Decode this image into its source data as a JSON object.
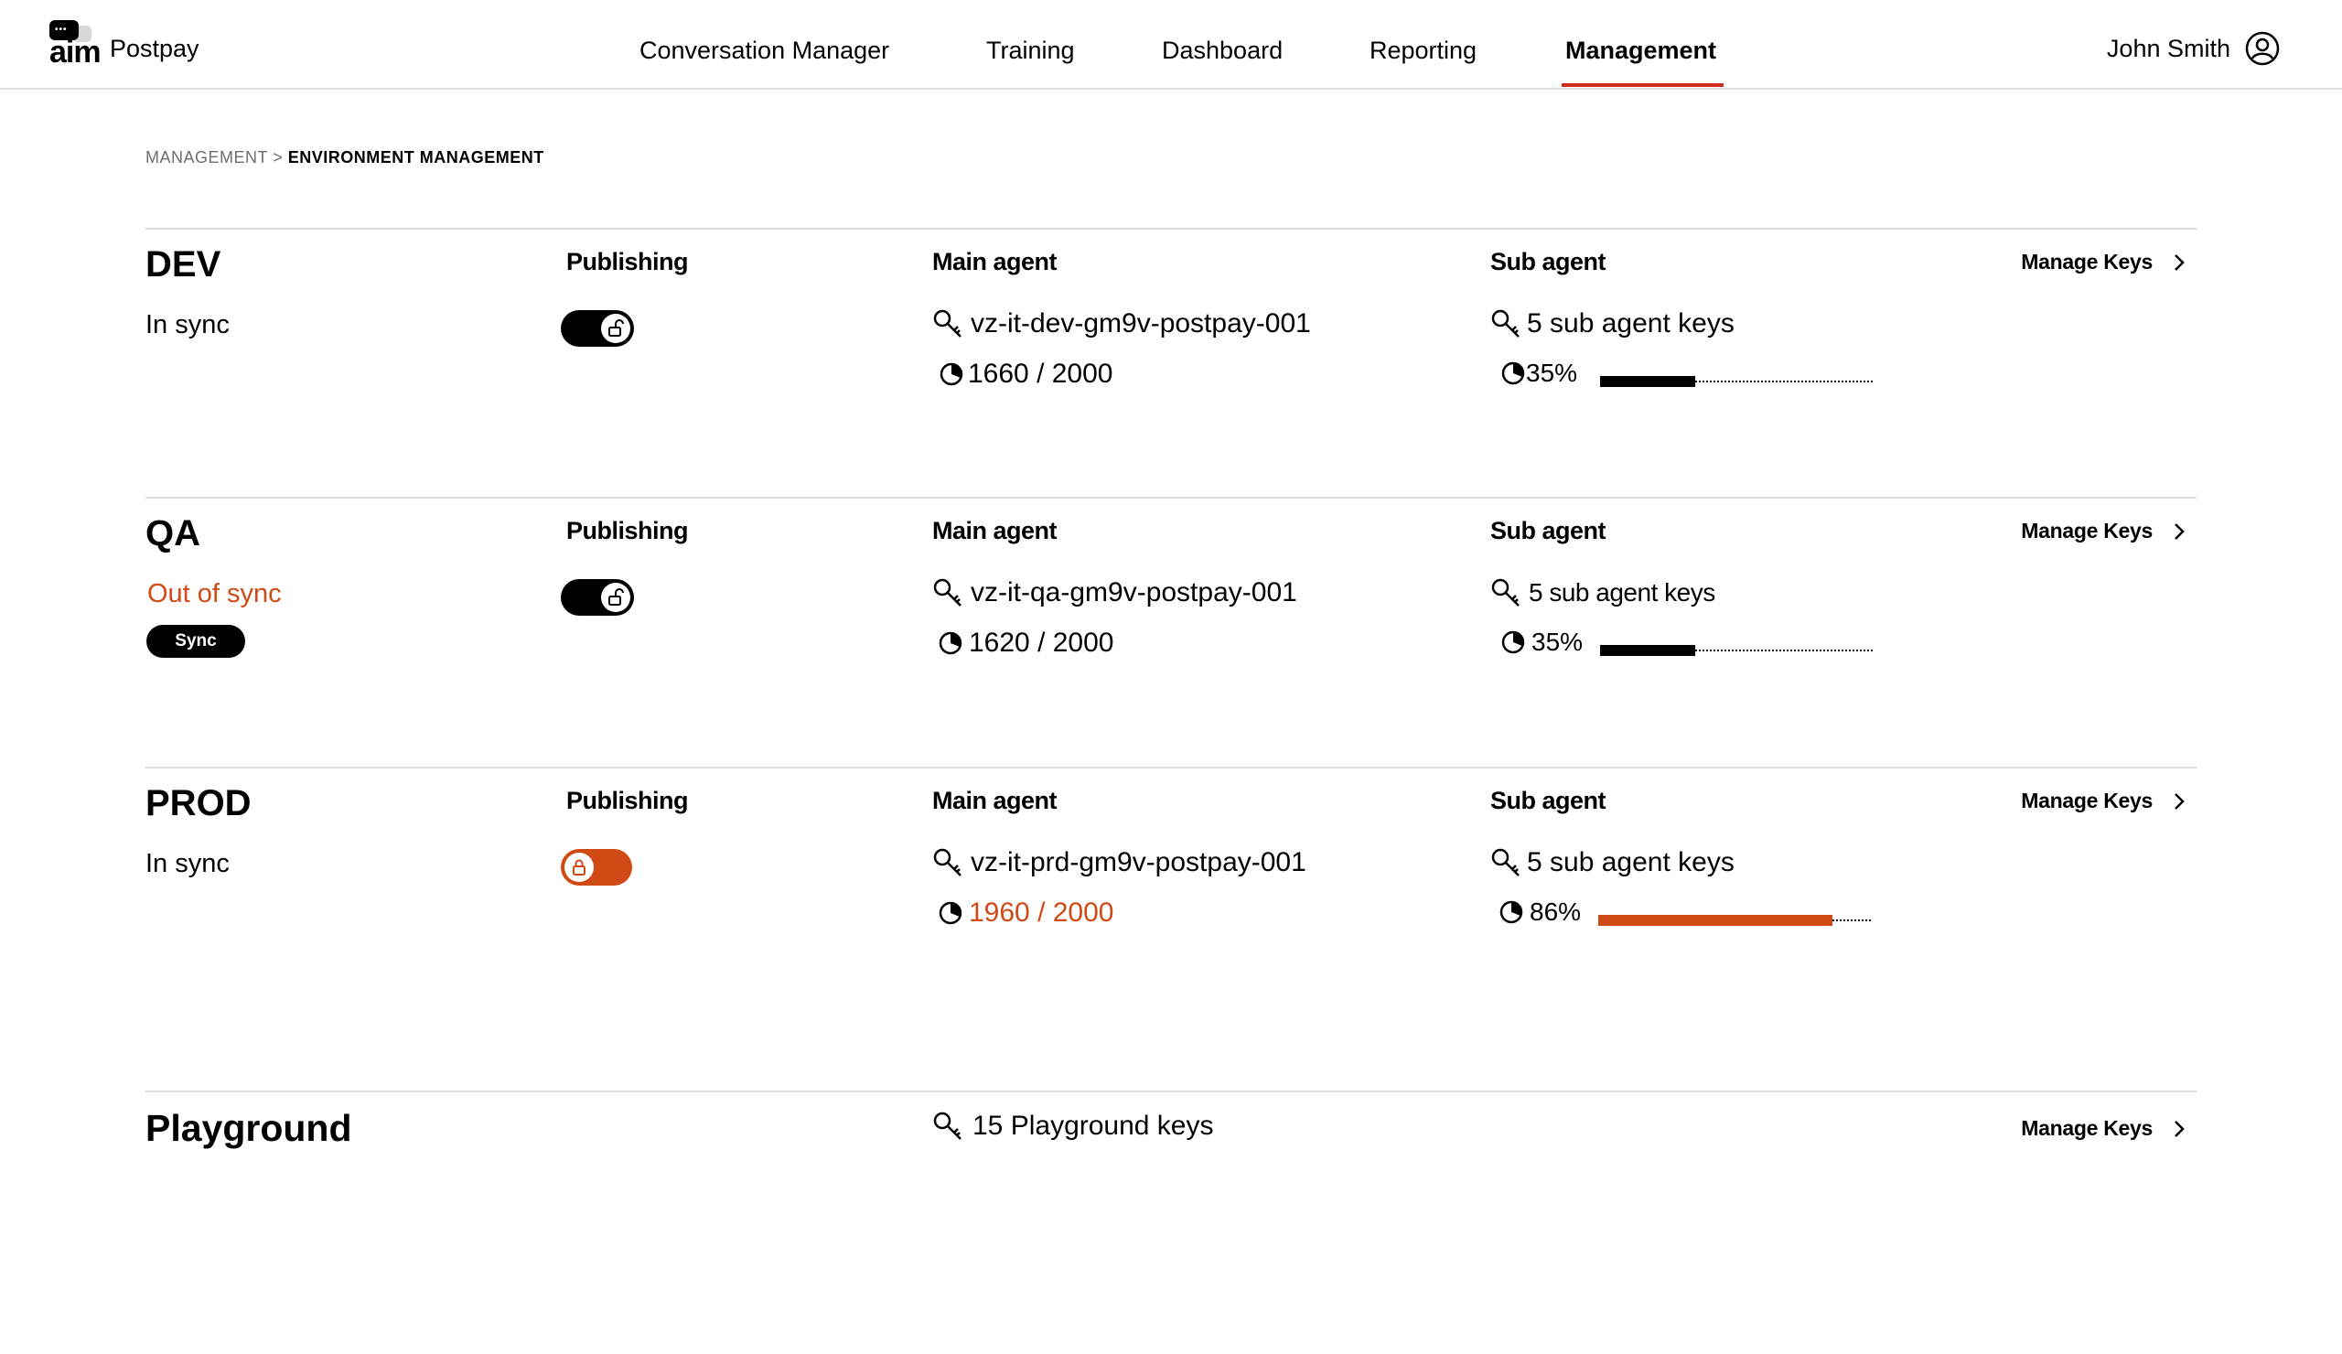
{
  "app": {
    "logo_text": "aim",
    "product": "Postpay"
  },
  "nav": {
    "items": [
      {
        "label": "Conversation Manager"
      },
      {
        "label": "Training"
      },
      {
        "label": "Dashboard"
      },
      {
        "label": "Reporting"
      },
      {
        "label": "Management",
        "active": true
      }
    ]
  },
  "user": {
    "name": "John Smith",
    "icon": "user-circle-icon"
  },
  "breadcrumb": {
    "parent": "MANAGEMENT",
    "separator": ">",
    "current": "ENVIRONMENT MANAGEMENT"
  },
  "colors": {
    "accent": "#d52b1e",
    "warning": "#d04a16",
    "divider": "#dcdcdc"
  },
  "environments": [
    {
      "name": "DEV",
      "status": "In sync",
      "publishing_label": "Publishing",
      "publishing_locked": false,
      "main_agent_label": "Main agent",
      "main_agent_id": "vz-it-dev-gm9v-postpay-001",
      "main_usage": "1660 / 2000",
      "sub_agent_label": "Sub agent",
      "sub_agent_keys": "5 sub agent keys",
      "sub_usage_percent": "35%",
      "sub_usage_fraction": 0.35,
      "manage_label": "Manage Keys"
    },
    {
      "name": "QA",
      "status": "Out of sync",
      "sync_button": "Sync",
      "publishing_label": "Publishing",
      "publishing_locked": false,
      "main_agent_label": "Main agent",
      "main_agent_id": "vz-it-qa-gm9v-postpay-001",
      "main_usage": "1620 / 2000",
      "sub_agent_label": "Sub agent",
      "sub_agent_keys": "5 sub agent keys",
      "sub_usage_percent": "35%",
      "sub_usage_fraction": 0.35,
      "manage_label": "Manage Keys"
    },
    {
      "name": "PROD",
      "status": "In sync",
      "publishing_label": "Publishing",
      "publishing_locked": true,
      "main_agent_label": "Main agent",
      "main_agent_id": "vz-it-prd-gm9v-postpay-001",
      "main_usage": "1960 / 2000",
      "sub_agent_label": "Sub agent",
      "sub_agent_keys": "5 sub agent keys",
      "sub_usage_percent": "86%",
      "sub_usage_fraction": 0.86,
      "manage_label": "Manage Keys"
    }
  ],
  "playground": {
    "name": "Playground",
    "keys": "15 Playground keys",
    "manage_label": "Manage Keys"
  }
}
